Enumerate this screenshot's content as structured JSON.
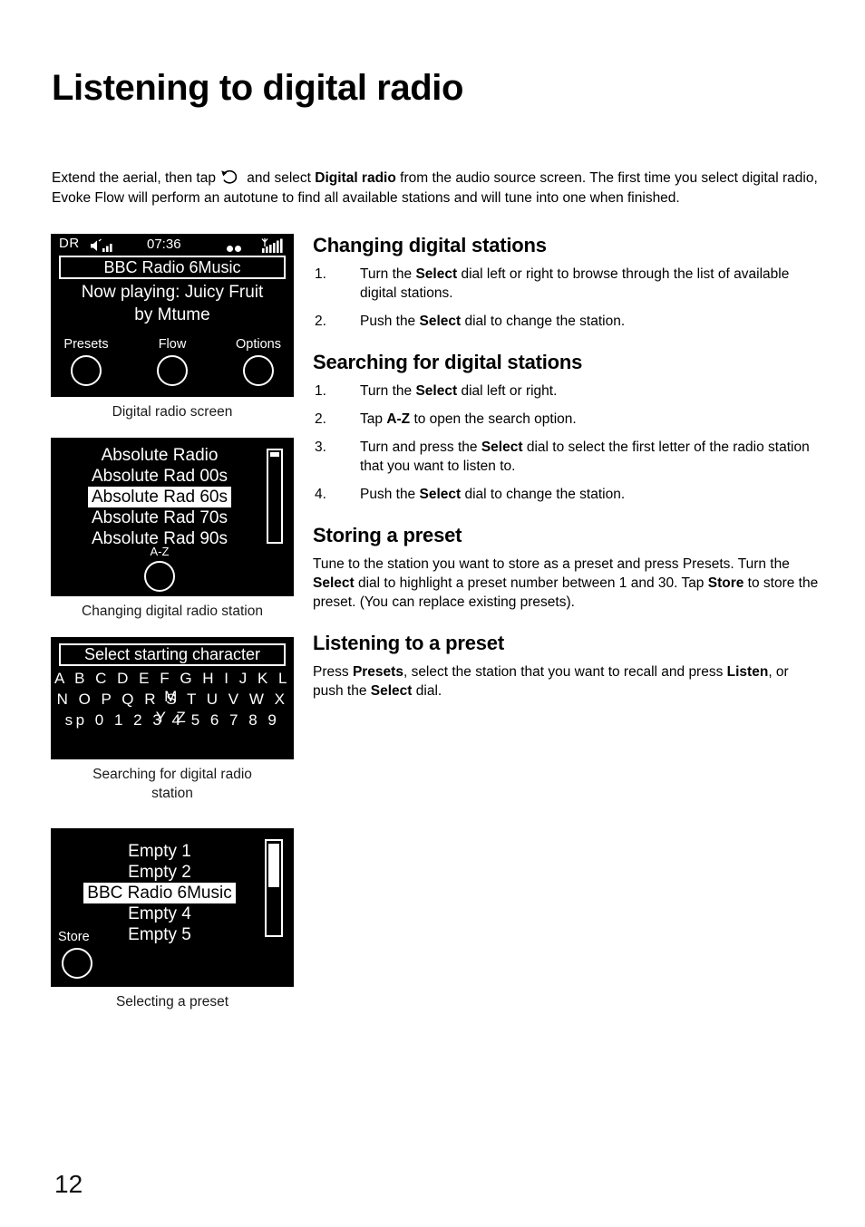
{
  "document": {
    "title": "Listening to digital radio",
    "page_number": "12"
  },
  "intro": {
    "before_icon": "Extend the aerial, then tap",
    "icon": "source-circle-arrow-icon",
    "after_icon": "and select",
    "bold_term": "Digital radio",
    "rest": "from the audio source screen. The first time you select digital radio, Evoke Flow will perform an autotune to find all available stations and will tune into one when finished."
  },
  "figures": [
    {
      "id": "digital-radio-screen",
      "caption": "Digital radio screen",
      "status_bar": {
        "source": "DR",
        "speaker_icon": "speaker-volume-icon",
        "time": "07:36",
        "dots": "••",
        "signal_icon": "signal-strength-icon"
      },
      "station": "BBC Radio 6Music",
      "now_playing_line1": "Now playing: Juicy Fruit",
      "now_playing_line2": "by Mtume",
      "softkeys": [
        "Presets",
        "Flow",
        "Options"
      ]
    },
    {
      "id": "changing-digital-radio-station",
      "caption": "Changing digital radio station",
      "items": [
        "Absolute Radio",
        "Absolute Rad 00s",
        "Absolute Rad 60s",
        "Absolute Rad 70s",
        "Absolute Rad 90s"
      ],
      "selected_index": 2,
      "softkey": "A-Z"
    },
    {
      "id": "searching-for-digital-radio-station",
      "caption_line1": "Searching for digital radio",
      "caption_line2": "station",
      "header": "Select starting character",
      "row1": "A B C D E F G H I J K L M",
      "row2": "N O P Q R S T U V W X Y Z",
      "row3": "sp 0 1 2 3 4 5 6 7 8 9"
    },
    {
      "id": "selecting-a-preset",
      "caption": "Selecting a preset",
      "items": [
        "Empty 1",
        "Empty 2",
        "BBC Radio 6Music",
        "Empty 4",
        "Empty 5"
      ],
      "selected_index": 2,
      "softkey": "Store"
    }
  ],
  "sections": [
    {
      "id": "changing-digital-stations",
      "heading": "Changing digital stations",
      "steps": [
        {
          "num": "1.",
          "pre": "Turn the ",
          "bold": "Select",
          "post": " dial left or right to browse through the list of available digital stations."
        },
        {
          "num": "2.",
          "pre": "Push the ",
          "bold": "Select",
          "post": " dial to change the station."
        }
      ]
    },
    {
      "id": "searching-for-digital-stations",
      "heading": "Searching for digital stations",
      "steps": [
        {
          "num": "1.",
          "pre": "Turn the ",
          "bold": "Select",
          "post": " dial left or right."
        },
        {
          "num": "2.",
          "pre": "Tap ",
          "bold": "A-Z",
          "post": " to open the search option."
        },
        {
          "num": "3.",
          "pre": "Turn and press the ",
          "bold": "Select",
          "post": " dial to select the first letter of the radio station that you want to listen to."
        },
        {
          "num": "4.",
          "pre": "Push the ",
          "bold": "Select",
          "post": " dial to change the station."
        }
      ]
    },
    {
      "id": "storing-a-preset",
      "heading": "Storing a preset",
      "paragraph_parts": [
        {
          "text": "Tune to the station you want to store as a preset and press Presets. Turn the ",
          "bold": false
        },
        {
          "text": "Select",
          "bold": true
        },
        {
          "text": " dial to highlight a preset number between 1 and 30. Tap ",
          "bold": false
        },
        {
          "text": "Store",
          "bold": true
        },
        {
          "text": " to store the preset. (You can replace existing presets).",
          "bold": false
        }
      ]
    },
    {
      "id": "listening-to-a-preset",
      "heading": "Listening to a preset",
      "paragraph_parts": [
        {
          "text": "Press ",
          "bold": false
        },
        {
          "text": "Presets",
          "bold": true
        },
        {
          "text": ", select the station that you want to recall and press ",
          "bold": false
        },
        {
          "text": "Listen",
          "bold": true
        },
        {
          "text": ", or push the ",
          "bold": false
        },
        {
          "text": "Select",
          "bold": true
        },
        {
          "text": " dial.",
          "bold": false
        }
      ]
    }
  ],
  "colors": {
    "screen_background": "#000000",
    "screen_foreground": "#ffffff",
    "page_background": "#ffffff",
    "text": "#000000"
  }
}
